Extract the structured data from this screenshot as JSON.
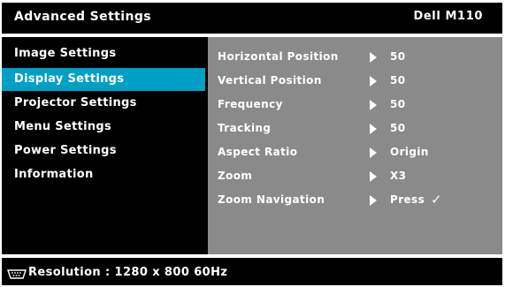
{
  "header": {
    "title": "Advanced Settings",
    "model": "Dell  M110"
  },
  "sidebar": {
    "items": [
      {
        "label": "Image Settings",
        "active": false
      },
      {
        "label": "Display Settings",
        "active": true
      },
      {
        "label": "Projector Settings",
        "active": false
      },
      {
        "label": "Menu Settings",
        "active": false
      },
      {
        "label": "Power Settings",
        "active": false
      },
      {
        "label": "Information",
        "active": false
      }
    ]
  },
  "settings": {
    "rows": [
      {
        "label": "Horizontal Position",
        "value": "50"
      },
      {
        "label": "Vertical Position",
        "value": "50"
      },
      {
        "label": "Frequency",
        "value": "50"
      },
      {
        "label": "Tracking",
        "value": "50"
      },
      {
        "label": "Aspect Ratio",
        "value": "Origin"
      },
      {
        "label": "Zoom",
        "value": "X3"
      },
      {
        "label": "Zoom Navigation",
        "value": "Press",
        "check": "✓"
      }
    ]
  },
  "footer": {
    "icon": "vga-connector-icon",
    "resolution": "Resolution : 1280 x 800 60Hz"
  },
  "colors": {
    "highlight": "#00a0c6",
    "panel": "#8a8a8a",
    "background": "#000000"
  }
}
